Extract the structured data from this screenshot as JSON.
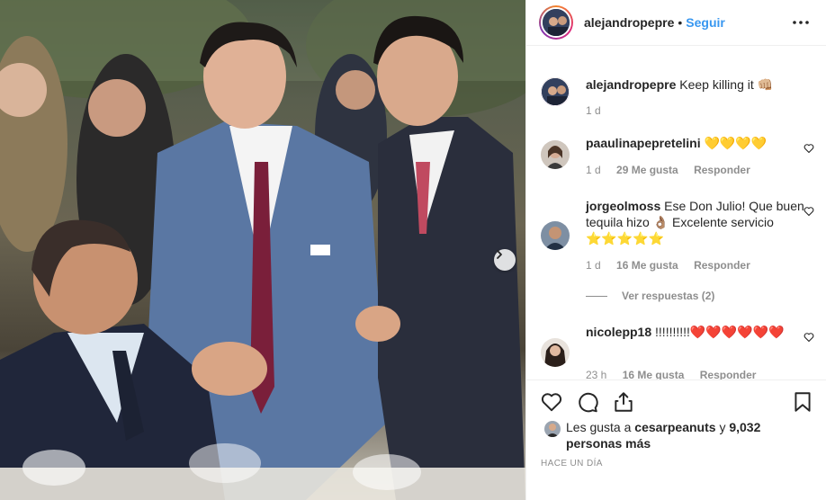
{
  "post": {
    "username": "alejandropepre",
    "dot": "•",
    "follow_label": "Seguir"
  },
  "caption": {
    "username": "alejandropepre",
    "text": "Keep killing it 👊🏼",
    "age": "1 d"
  },
  "comments": [
    {
      "username": "paaulinapepretelini",
      "text": "💛💛💛💛",
      "age": "1 d",
      "likes": "29 Me gusta",
      "reply_label": "Responder"
    },
    {
      "username": "jorgeolmoss",
      "text": "Ese Don Julio! Que buen tequila hizo 👌🏽 Excelente servicio ⭐⭐⭐⭐⭐",
      "age": "1 d",
      "likes": "16 Me gusta",
      "reply_label": "Responder",
      "view_replies": "Ver respuestas (2)"
    },
    {
      "username": "nicolepp18",
      "text": "!!!!!!!!!!❤️❤️❤️❤️❤️❤️",
      "age": "23 h",
      "likes": "16 Me gusta",
      "reply_label": "Responder"
    }
  ],
  "likes_summary": {
    "prefix": "Les gusta a",
    "user": "cesarpeanuts",
    "connector": "y",
    "count": "9,032 personas más"
  },
  "timestamp": "Hace un día",
  "icons": {
    "more": "more-horizontal-icon",
    "heart": "heart-icon",
    "comment": "comment-icon",
    "share": "share-icon",
    "save": "bookmark-icon",
    "next": "chevron-right-icon"
  },
  "colors": {
    "link_blue": "#3897f0",
    "text": "#262626",
    "muted": "#8e8e8e",
    "border": "#efefef"
  }
}
